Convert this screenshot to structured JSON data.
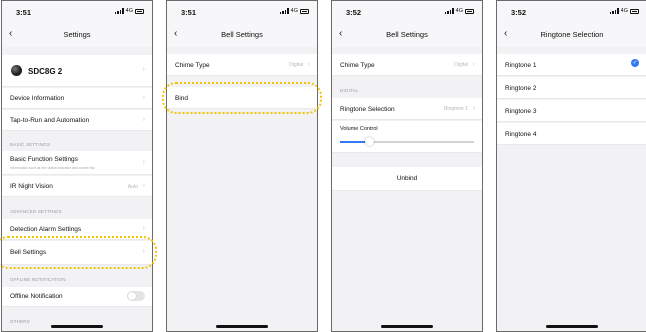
{
  "status_bar": {
    "network": "4G"
  },
  "screen1": {
    "time": "3:51",
    "title": "Settings",
    "device_name": "SDC8G 2",
    "device_information": "Device Information",
    "tap_to_run": "Tap-to-Run and Automation",
    "basic_settings_header": "BASIC SETTINGS",
    "basic_function_settings": "Basic Function Settings",
    "basic_function_sub": "Information such as the status indicator and screen flip",
    "ir_night_vision": "IR Night Vision",
    "ir_night_vision_value": "Auto",
    "advanced_settings_header": "ADVANCED SETTINGS",
    "detection_alarm_settings": "Detection Alarm Settings",
    "bell_settings": "Bell Settings",
    "offline_notification_header": "OFFLINE NOTIFICATION",
    "offline_notification": "Offline Notification",
    "offline_notification_on": false,
    "others_header": "OTHERS"
  },
  "screen2": {
    "time": "3:51",
    "title": "Bell Settings",
    "chime_type": "Chime Type",
    "chime_type_value": "Digital",
    "bind": "Bind"
  },
  "screen3": {
    "time": "3:52",
    "title": "Bell Settings",
    "chime_type": "Chime Type",
    "chime_type_value": "Digital",
    "digital_header": "DIGITAL",
    "ringtone_selection": "Ringtone Selection",
    "ringtone_selection_value": "Ringtone 1",
    "volume_control": "Volume Control",
    "volume_level": 0.22,
    "unbind": "Unbind"
  },
  "screen4": {
    "time": "3:52",
    "title": "Ringtone Selection",
    "ringtones": [
      "Ringtone 1",
      "Ringtone 2",
      "Ringtone 3",
      "Ringtone 4"
    ],
    "selected_index": 0
  },
  "colors": {
    "accent": "#3478f6",
    "highlight": "#f5c400",
    "background": "#f2f2f4"
  }
}
